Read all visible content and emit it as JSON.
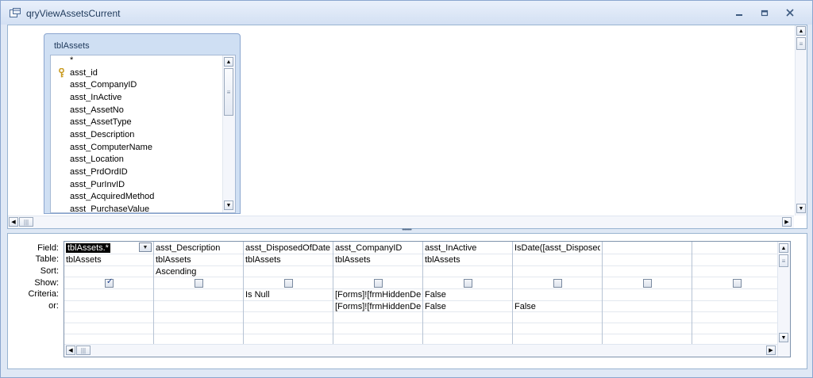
{
  "window": {
    "title": "qryViewAssetsCurrent",
    "controls": {
      "minimize": "–",
      "restore": "▫",
      "close": "✕"
    }
  },
  "table_box": {
    "title": "tblAssets",
    "fields": [
      "*",
      "asst_id",
      "asst_CompanyID",
      "asst_InActive",
      "asst_AssetNo",
      "asst_AssetType",
      "asst_Description",
      "asst_ComputerName",
      "asst_Location",
      "asst_PrdOrdID",
      "asst_PurInvID",
      "asst_AcquiredMethod",
      "asst_PurchaseValue"
    ],
    "key_field": "asst_id"
  },
  "splitter": "••••••••",
  "grid": {
    "row_labels": {
      "field": "Field:",
      "table": "Table:",
      "sort": "Sort:",
      "show": "Show:",
      "criteria": "Criteria:",
      "or": "or:"
    },
    "columns": [
      {
        "field": "tblAssets.*",
        "table": "tblAssets",
        "sort": "",
        "show": true,
        "criteria": "",
        "or": ""
      },
      {
        "field": "asst_Description",
        "table": "tblAssets",
        "sort": "Ascending",
        "show": false,
        "criteria": "",
        "or": ""
      },
      {
        "field": "asst_DisposedOfDate",
        "table": "tblAssets",
        "sort": "",
        "show": false,
        "criteria": "Is Null",
        "or": ""
      },
      {
        "field": "asst_CompanyID",
        "table": "tblAssets",
        "sort": "",
        "show": false,
        "criteria": "[Forms]![frmHiddenDe",
        "or": "[Forms]![frmHiddenDe"
      },
      {
        "field": "asst_InActive",
        "table": "tblAssets",
        "sort": "",
        "show": false,
        "criteria": "False",
        "or": "False"
      },
      {
        "field": "IsDate([asst_Disposed",
        "table": "",
        "sort": "",
        "show": false,
        "criteria": "",
        "or": "False"
      },
      {
        "field": "",
        "table": "",
        "sort": "",
        "show": false,
        "criteria": "",
        "or": ""
      },
      {
        "field": "",
        "table": "",
        "sort": "",
        "show": false,
        "criteria": "",
        "or": ""
      }
    ]
  },
  "icons": {
    "title": "query-design-icon",
    "key": "primary-key-icon",
    "scroll_up": "▲",
    "scroll_down": "▼",
    "scroll_left": "◀",
    "scroll_right": "▶",
    "grip": "≡",
    "dropdown": "▼"
  }
}
